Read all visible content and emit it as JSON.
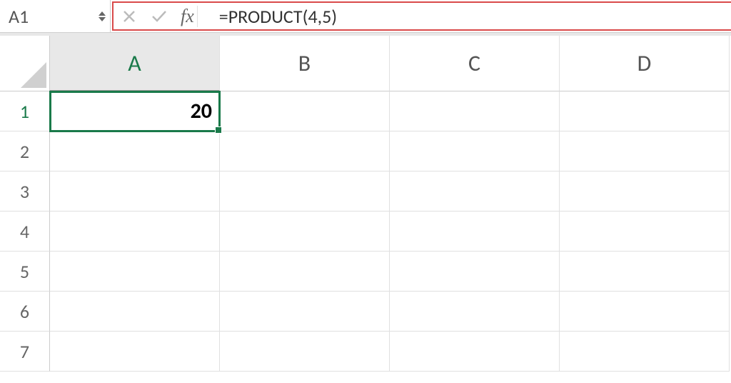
{
  "name_box": {
    "value": "A1"
  },
  "formula_bar": {
    "fx_label": "fx",
    "value": "=PRODUCT(4,5)"
  },
  "columns": [
    "A",
    "B",
    "C",
    "D"
  ],
  "rows": [
    "1",
    "2",
    "3",
    "4",
    "5",
    "6",
    "7"
  ],
  "selected_cell": {
    "row": 0,
    "col": 0,
    "value": "20"
  },
  "colors": {
    "selection_green": "#1a7a4a",
    "highlight_red": "#d94a4a"
  }
}
